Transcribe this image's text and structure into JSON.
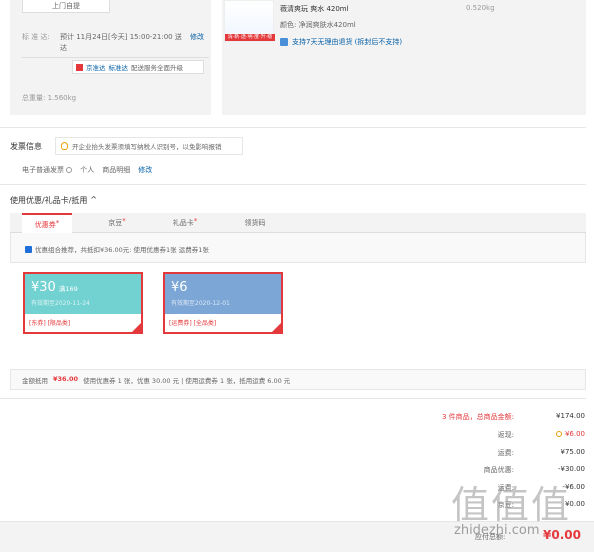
{
  "delivery": {
    "pickup_button": "上门自提",
    "standard_label": "标 准 达:",
    "standard_text": "预计 11月24日[今天] 15:00-21:00 送达",
    "edit": "修改",
    "upgrade": {
      "text1": "京准达",
      "text2": "标准达",
      "text3": "配送服务全面升级"
    },
    "weight_label": "总重量: 1.560kg"
  },
  "product": {
    "image_tag": "清·新·透·明·度·升·级",
    "name": "薇清爽玩 爽水 420ml",
    "weight": "0.520kg",
    "color": "颜色: 净润爽肤水420ml",
    "return_policy": "支持7天无理由退货 (拆封后不支持)"
  },
  "invoice": {
    "title": "发票信息",
    "tip": "开企业抬头发票须填写纳税人识别号，以免影响报销",
    "type": "电子普通发票",
    "person": "个人",
    "content": "商品明细",
    "edit": "修改"
  },
  "coupons": {
    "title": "使用优惠/礼品卡/抵用",
    "chevron": "^",
    "tabs": [
      {
        "label": "优惠券",
        "star": "*"
      },
      {
        "label": "京豆",
        "star": "*"
      },
      {
        "label": "礼品卡",
        "star": "*"
      },
      {
        "label": "领货码",
        "star": ""
      }
    ],
    "best_combo": "优惠组合推荐，共抵扣¥36.00元: 使用优惠券1张 运费券1张",
    "items": [
      {
        "amount": "¥30",
        "condition": "满169",
        "expiry": "有效期至2020-11-24",
        "tags": "[东券] [限品类]"
      },
      {
        "amount": "¥6",
        "condition": "",
        "expiry": "有效期至2020-12-01",
        "tags": "[运费券] [全品类]"
      }
    ],
    "summary_label": "金额抵用",
    "summary_amount": "¥36.00",
    "summary_text": "使用优惠券 1 张，优惠 30.00 元 | 使用运费券 1 张，抵用运费 6.00 元"
  },
  "totals": {
    "items_label": "3 件商品，总商品金额:",
    "items_value": "¥174.00",
    "rebate_label": "返现:",
    "rebate_value": "¥6.00",
    "shipping_label": "运费:",
    "shipping_value": "¥75.00",
    "discount_label": "商品优惠:",
    "discount_value": "-¥30.00",
    "r5_label": "运费:",
    "r5_value": "-¥6.00",
    "r6_label": "京豆:",
    "r6_value": "¥0.00",
    "pay_label": "应付总额:",
    "pay_amount": "¥0.00"
  },
  "watermark": {
    "glyphs": "值值值",
    "text": "zhidezhi.com"
  },
  "colors": {
    "accent": "#e4393c",
    "link": "#005ea7",
    "coupon1": "#72d1d1",
    "coupon2": "#7ba6d6"
  }
}
